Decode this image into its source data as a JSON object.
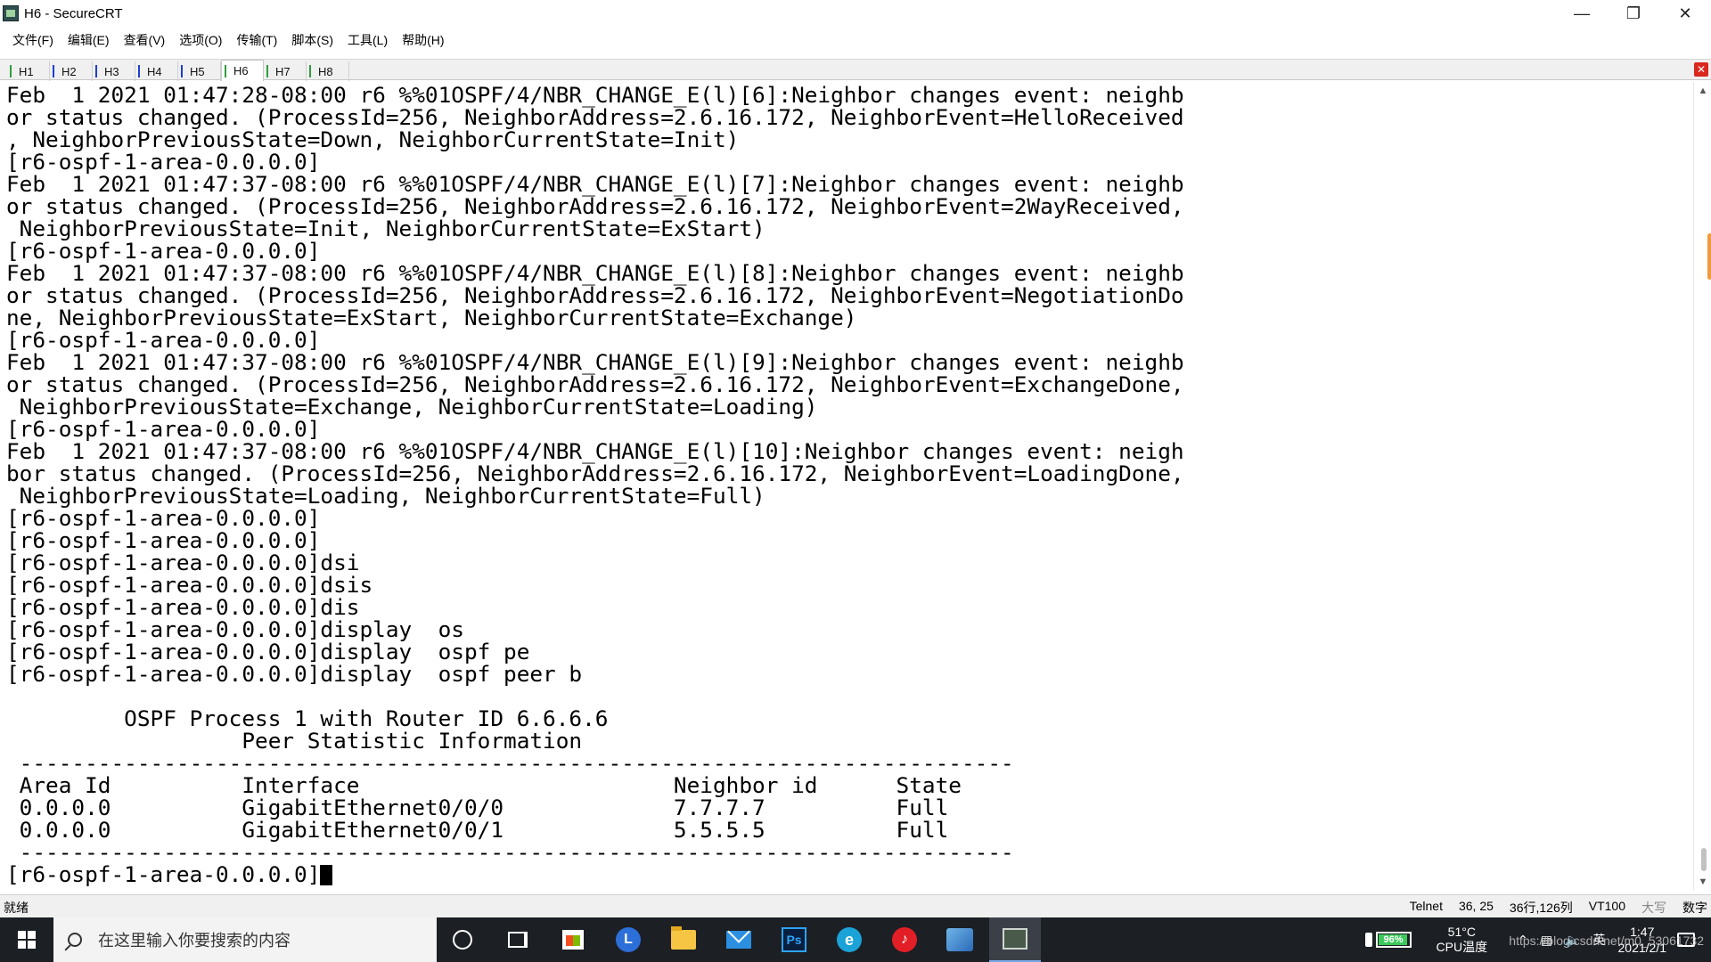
{
  "window": {
    "title": "H6 - SecureCRT"
  },
  "menu": [
    "文件(F)",
    "编辑(E)",
    "查看(V)",
    "选项(O)",
    "传输(T)",
    "脚本(S)",
    "工具(L)",
    "帮助(H)"
  ],
  "tabs": [
    {
      "label": "H1",
      "mark_color": "#2e9e3e"
    },
    {
      "label": "H2",
      "mark_color": "#1a3fd6"
    },
    {
      "label": "H3",
      "mark_color": "#1a3fd6"
    },
    {
      "label": "H4",
      "mark_color": "#1a3fd6"
    },
    {
      "label": "H5",
      "mark_color": "#1a3fd6"
    },
    {
      "label": "H6",
      "mark_color": "#2e9e3e"
    },
    {
      "label": "H7",
      "mark_color": "#2e9e3e"
    },
    {
      "label": "H8",
      "mark_color": "#2e9e3e"
    }
  ],
  "active_tab": "H6",
  "terminal": {
    "lines": [
      "Feb  1 2021 01:47:28-08:00 r6 %%01OSPF/4/NBR_CHANGE_E(l)[6]:Neighbor changes event: neighb",
      "or status changed. (ProcessId=256, NeighborAddress=2.6.16.172, NeighborEvent=HelloReceived",
      ", NeighborPreviousState=Down, NeighborCurrentState=Init)",
      "[r6-ospf-1-area-0.0.0.0]",
      "Feb  1 2021 01:47:37-08:00 r6 %%01OSPF/4/NBR_CHANGE_E(l)[7]:Neighbor changes event: neighb",
      "or status changed. (ProcessId=256, NeighborAddress=2.6.16.172, NeighborEvent=2WayReceived,",
      " NeighborPreviousState=Init, NeighborCurrentState=ExStart)",
      "[r6-ospf-1-area-0.0.0.0]",
      "Feb  1 2021 01:47:37-08:00 r6 %%01OSPF/4/NBR_CHANGE_E(l)[8]:Neighbor changes event: neighb",
      "or status changed. (ProcessId=256, NeighborAddress=2.6.16.172, NeighborEvent=NegotiationDo",
      "ne, NeighborPreviousState=ExStart, NeighborCurrentState=Exchange)",
      "[r6-ospf-1-area-0.0.0.0]",
      "Feb  1 2021 01:47:37-08:00 r6 %%01OSPF/4/NBR_CHANGE_E(l)[9]:Neighbor changes event: neighb",
      "or status changed. (ProcessId=256, NeighborAddress=2.6.16.172, NeighborEvent=ExchangeDone,",
      " NeighborPreviousState=Exchange, NeighborCurrentState=Loading)",
      "[r6-ospf-1-area-0.0.0.0]",
      "Feb  1 2021 01:47:37-08:00 r6 %%01OSPF/4/NBR_CHANGE_E(l)[10]:Neighbor changes event: neigh",
      "bor status changed. (ProcessId=256, NeighborAddress=2.6.16.172, NeighborEvent=LoadingDone,",
      " NeighborPreviousState=Loading, NeighborCurrentState=Full)",
      "[r6-ospf-1-area-0.0.0.0]",
      "[r6-ospf-1-area-0.0.0.0]",
      "[r6-ospf-1-area-0.0.0.0]dsi",
      "[r6-ospf-1-area-0.0.0.0]dsis",
      "[r6-ospf-1-area-0.0.0.0]dis",
      "[r6-ospf-1-area-0.0.0.0]display  os",
      "[r6-ospf-1-area-0.0.0.0]display  ospf pe",
      "[r6-ospf-1-area-0.0.0.0]display  ospf peer b",
      "",
      "         OSPF Process 1 with Router ID 6.6.6.6",
      "                  Peer Statistic Information",
      " ----------------------------------------------------------------------------",
      " Area Id          Interface                        Neighbor id      State",
      " 0.0.0.0          GigabitEthernet0/0/0             7.7.7.7          Full",
      " 0.0.0.0          GigabitEthernet0/0/1             5.5.5.5          Full",
      " ----------------------------------------------------------------------------"
    ],
    "prompt": "[r6-ospf-1-area-0.0.0.0]"
  },
  "status": {
    "ready": "就绪",
    "protocol": "Telnet",
    "cursor_pos": "36, 25",
    "size": "36行,126列",
    "emulation": "VT100",
    "caps": "大写",
    "num": "数字"
  },
  "taskbar": {
    "search_placeholder": "在这里输入你要搜索的内容",
    "battery": "96%",
    "battery_level": 0.96,
    "temp_value": "51°C",
    "temp_label": "CPU温度",
    "ime": "英",
    "time": "1:47",
    "date": "2021/2/1",
    "watermark": "https://blog.csdn.net/m0_53061732"
  },
  "icons": {
    "app": "securecrt-icon",
    "battery_color": "#3cc95b",
    "close_tab_color": "#d9281e"
  }
}
